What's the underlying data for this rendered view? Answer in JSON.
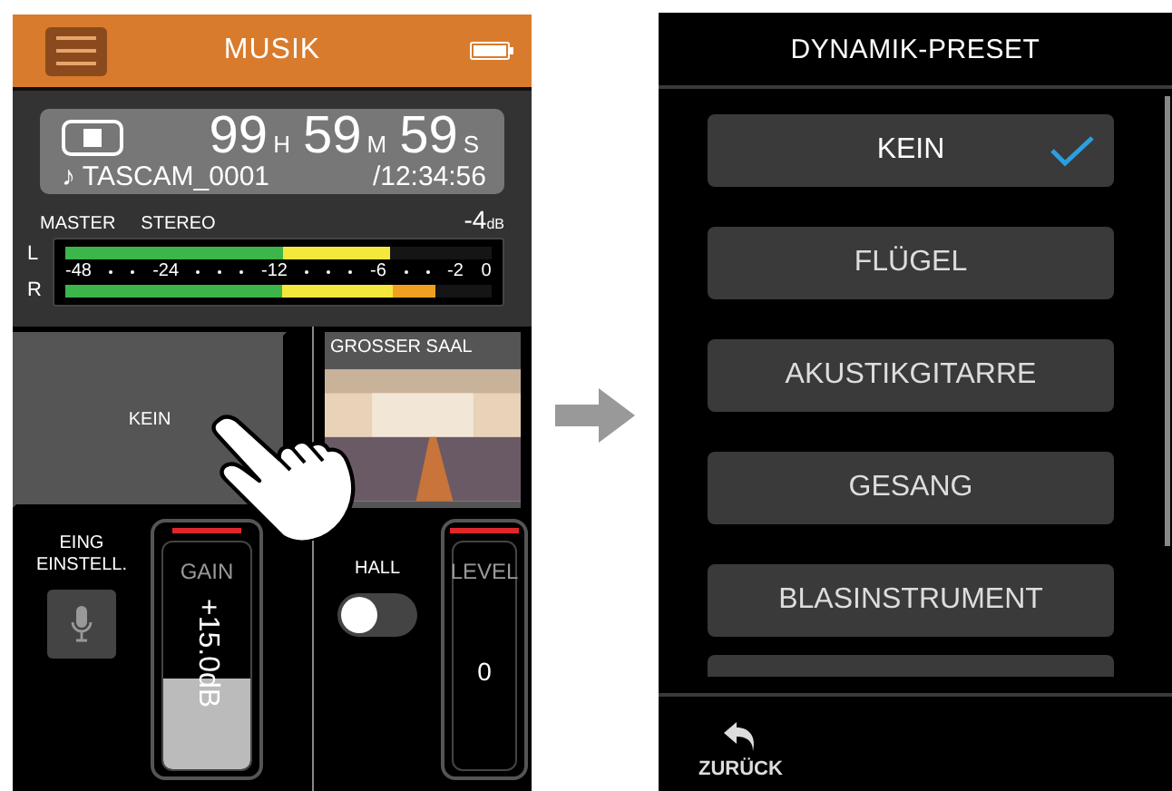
{
  "left_screen": {
    "header": {
      "title": "MUSIK"
    },
    "counter": {
      "hours": "99",
      "hours_unit": "H",
      "minutes": "59",
      "minutes_unit": "M",
      "seconds": "59",
      "seconds_unit": "S",
      "file_name": "♪ TASCAM_0001",
      "total": "/12:34:56"
    },
    "meter": {
      "labels": [
        "MASTER",
        "STEREO"
      ],
      "reading": "-4",
      "reading_unit": "dB",
      "scale": [
        "-48",
        "-24",
        "-12",
        "-6",
        "-2",
        "0"
      ],
      "channels": [
        {
          "name": "L",
          "level": 0.76
        },
        {
          "name": "R",
          "level": 0.87
        }
      ]
    },
    "preset_tile": {
      "label": "KEIN"
    },
    "reverb_tile": {
      "label": "GROSSER SAAL"
    },
    "input_settings": {
      "label_lines": [
        "EING",
        "EINSTELL."
      ]
    },
    "gain": {
      "label": "GAIN",
      "value": "+15.0dB",
      "level": 0.4
    },
    "reverb": {
      "label": "HALL",
      "on": false
    },
    "reverb_level": {
      "label": "LEVEL",
      "value": "0"
    }
  },
  "right_screen": {
    "title": "DYNAMIK-PRESET",
    "items": [
      {
        "label": "KEIN",
        "selected": true
      },
      {
        "label": "FLÜGEL",
        "selected": false
      },
      {
        "label": "AKUSTIKGITARRE",
        "selected": false
      },
      {
        "label": "GESANG",
        "selected": false
      },
      {
        "label": "BLASINSTRUMENT",
        "selected": false
      }
    ],
    "back": {
      "label": "ZURÜCK"
    }
  }
}
